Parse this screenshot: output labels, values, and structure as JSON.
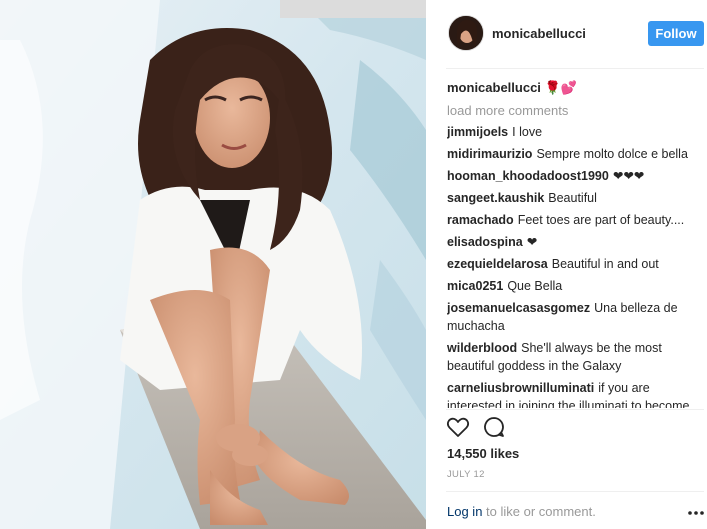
{
  "header": {
    "username": "monicabellucci",
    "follow_label": "Follow"
  },
  "caption": {
    "user": "monicabellucci",
    "text": "🌹💕"
  },
  "load_more": "load more comments",
  "comments": [
    {
      "user": "jimmijoels",
      "text": "I love"
    },
    {
      "user": "midirimaurizio",
      "text": "Sempre molto dolce e bella"
    },
    {
      "user": "hooman_khoodadoost1990",
      "text": "❤❤❤"
    },
    {
      "user": "sangeet.kaushik",
      "text": "Beautiful"
    },
    {
      "user": "ramachado",
      "text": "Feet toes are part of beauty...."
    },
    {
      "user": "elisadospina",
      "text": "❤"
    },
    {
      "user": "ezequieldelarosa",
      "text": "Beautiful in and out"
    },
    {
      "user": "mica0251",
      "text": "Que Bella"
    },
    {
      "user": "josemanuelcasasgomez",
      "text": "Una belleza de muchacha"
    },
    {
      "user": "wilderblood",
      "text": "She'll always be the most beautiful goddess in the Galaxy"
    },
    {
      "user": "carneliusbrownilluminati",
      "text": "if you are interested in joining the illuminati to become"
    }
  ],
  "actions": {
    "like_icon": "heart-icon",
    "comment_icon": "comment-icon"
  },
  "likes": "14,550 likes",
  "date": "JULY 12",
  "footer": {
    "login_label": "Log in",
    "login_suffix": " to like or comment.",
    "more_icon": "more-options-icon"
  },
  "colors": {
    "accent": "#3897f0",
    "link": "#003569",
    "muted": "#999999"
  }
}
